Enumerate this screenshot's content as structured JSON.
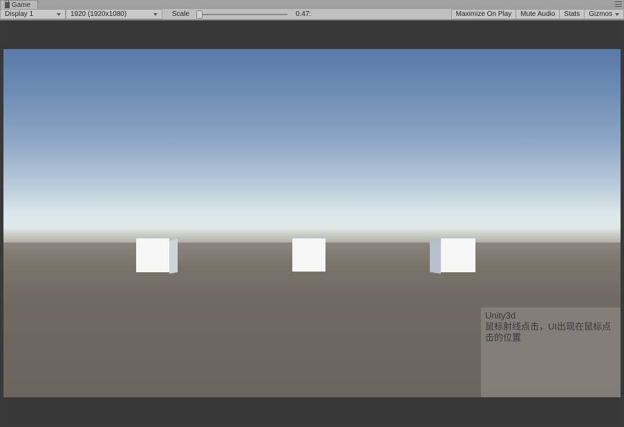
{
  "tab": {
    "title": "Game"
  },
  "toolbar": {
    "display_label": "Display 1",
    "resolution_label": "1920 (1920x1080)",
    "scale_label": "Scale",
    "scale_value": "0.47:",
    "maximize_label": "Maximize On Play",
    "mute_label": "Mute Audio",
    "stats_label": "Stats",
    "gizmos_label": "Gizmos"
  },
  "overlay": {
    "line1": "Unity3d",
    "line2": "鼠标射线点击，UI出现在鼠标点击的位置"
  }
}
